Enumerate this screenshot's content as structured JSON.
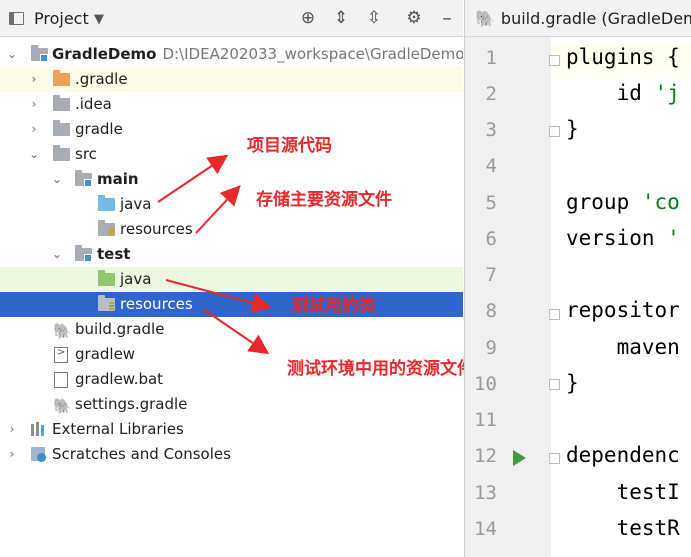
{
  "project_panel": {
    "title": "Project",
    "tree": [
      {
        "label": "GradleDemo",
        "path": "D:\\IDEA202033_workspace\\GradleDemo"
      },
      {
        "label": ".gradle"
      },
      {
        "label": ".idea"
      },
      {
        "label": "gradle"
      },
      {
        "label": "src"
      },
      {
        "label": "main"
      },
      {
        "label": "java"
      },
      {
        "label": "resources"
      },
      {
        "label": "test"
      },
      {
        "label": "java"
      },
      {
        "label": "resources"
      },
      {
        "label": "build.gradle"
      },
      {
        "label": "gradlew"
      },
      {
        "label": "gradlew.bat"
      },
      {
        "label": "settings.gradle"
      },
      {
        "label": "External Libraries"
      },
      {
        "label": "Scratches and Consoles"
      }
    ]
  },
  "annotations": {
    "a1": "项目源代码",
    "a2": "存储主要资源文件",
    "a3": "测试用的类",
    "a4": "测试环境中用的资源文件"
  },
  "editor": {
    "tab_label": "build.gradle (GradleDemo)",
    "line_numbers": [
      "1",
      "2",
      "3",
      "4",
      "5",
      "6",
      "7",
      "8",
      "9",
      "10",
      "11",
      "12",
      "13",
      "14"
    ],
    "code": {
      "l1": "plugins {",
      "l2a": "    id ",
      "l2b": "'j",
      "l3": "}",
      "l5a": "group ",
      "l5b": "'co",
      "l6a": "version ",
      "l6b": "'",
      "l8": "repositor",
      "l9": "    maven",
      "l10": "}",
      "l12": "dependenc",
      "l13": "    testI",
      "l14": "    testR"
    }
  },
  "colors": {
    "selection": "#2f65ca",
    "annotation": "#e8282b",
    "string": "#067d17"
  }
}
